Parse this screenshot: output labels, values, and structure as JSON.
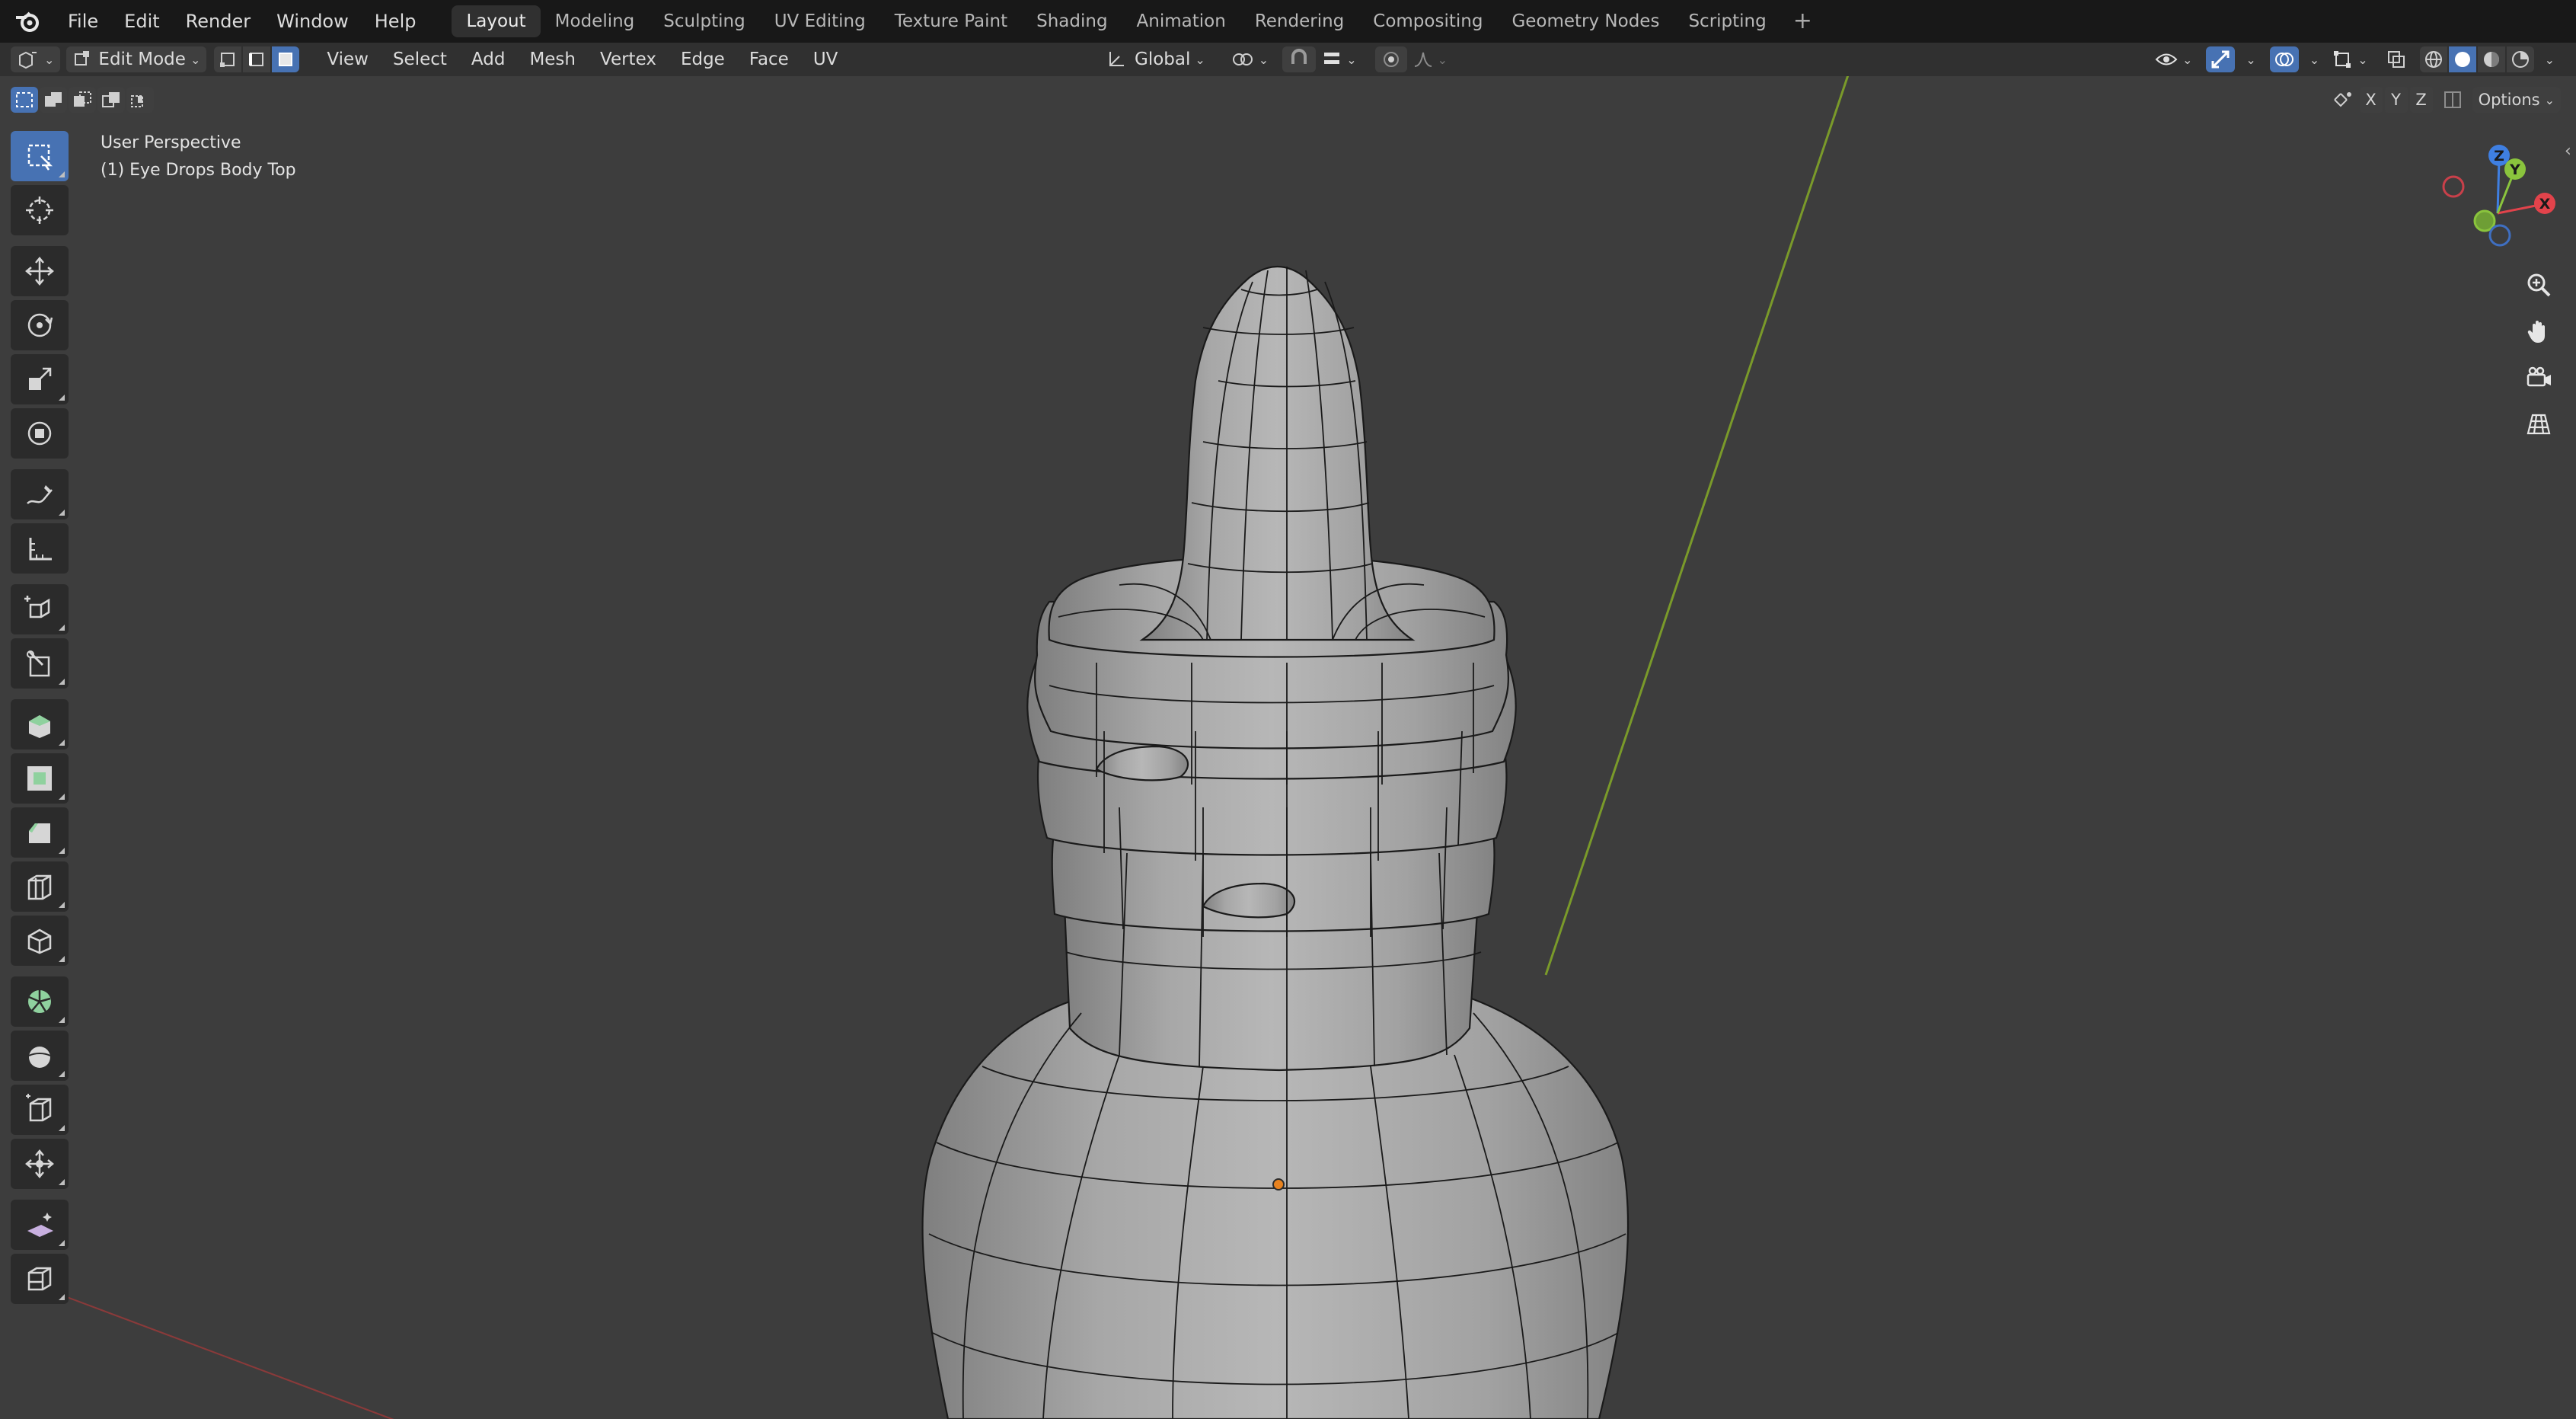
{
  "menubar": {
    "items": [
      "File",
      "Edit",
      "Render",
      "Window",
      "Help"
    ],
    "workspaces": [
      "Layout",
      "Modeling",
      "Sculpting",
      "UV Editing",
      "Texture Paint",
      "Shading",
      "Animation",
      "Rendering",
      "Compositing",
      "Geometry Nodes",
      "Scripting"
    ],
    "active_workspace": "Layout",
    "add_label": "+"
  },
  "header": {
    "mode": "Edit Mode",
    "menus": [
      "View",
      "Select",
      "Add",
      "Mesh",
      "Vertex",
      "Edge",
      "Face",
      "UV"
    ],
    "orientation": "Global",
    "options": "Options",
    "axes": [
      "X",
      "Y",
      "Z"
    ]
  },
  "viewport": {
    "view_name": "User Perspective",
    "object_name": "(1) Eye Drops Body Top"
  },
  "gizmo": {
    "x": "X",
    "y": "Y",
    "z": "Z",
    "x_color": "#e2434b",
    "y_color": "#8ac43d",
    "z_color": "#3f7fe1"
  },
  "colors": {
    "accent": "#4772b3",
    "background": "#3d3d3d",
    "mesh": "#a8a8a8",
    "y_axis_line": "#7a9a2a",
    "x_axis_line": "#8a3a3a"
  },
  "icons": {
    "tools": [
      "select-box-icon",
      "cursor-icon",
      "move-icon",
      "rotate-icon",
      "scale-icon",
      "transform-icon",
      "annotate-icon",
      "measure-icon",
      "add-cube-icon",
      "knife-icon",
      "extrude-icon",
      "inset-icon",
      "bevel-icon",
      "loop-cut-icon",
      "poly-build-icon",
      "spin-icon",
      "smooth-icon",
      "shrink-fatten-icon",
      "push-pull-icon",
      "shear-icon",
      "rip-icon"
    ],
    "nav": [
      "zoom-icon",
      "pan-icon",
      "camera-icon",
      "grid-view-icon"
    ]
  }
}
